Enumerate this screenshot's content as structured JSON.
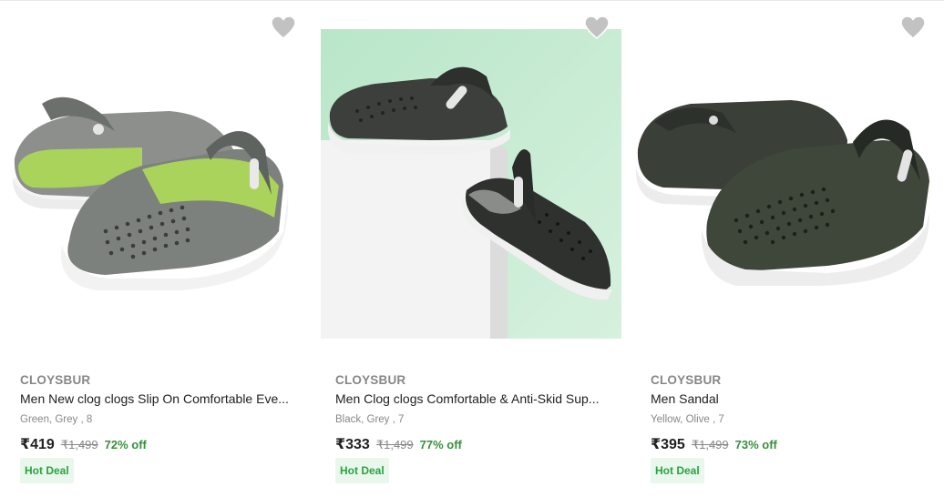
{
  "products": [
    {
      "brand": "CLOYSBUR",
      "title": "Men New clog clogs Slip On Comfortable Eve...",
      "variant": "Green, Grey , 8",
      "price": "₹419",
      "mrp": "₹1,499",
      "discount": "72% off",
      "badge": "Hot Deal",
      "image": "grey-green-clogs-pair"
    },
    {
      "brand": "CLOYSBUR",
      "title": "Men Clog clogs Comfortable & Anti-Skid Sup...",
      "variant": "Black, Grey , 7",
      "price": "₹333",
      "mrp": "₹1,499",
      "discount": "77% off",
      "badge": "Hot Deal",
      "image": "black-clogs-on-white-block-green-background"
    },
    {
      "brand": "CLOYSBUR",
      "title": "Men Sandal",
      "variant": "Yellow, Olive , 7",
      "price": "₹395",
      "mrp": "₹1,499",
      "discount": "73% off",
      "badge": "Hot Deal",
      "image": "olive-black-clogs-pair"
    }
  ],
  "icons": {
    "wishlist": "heart-icon"
  },
  "colors": {
    "wishlist_heart": "#c2c2c2",
    "brand_text": "#878787",
    "discount_green": "#388e3c",
    "deal_bg": "#e9f7ec",
    "deal_text": "#26a541"
  }
}
